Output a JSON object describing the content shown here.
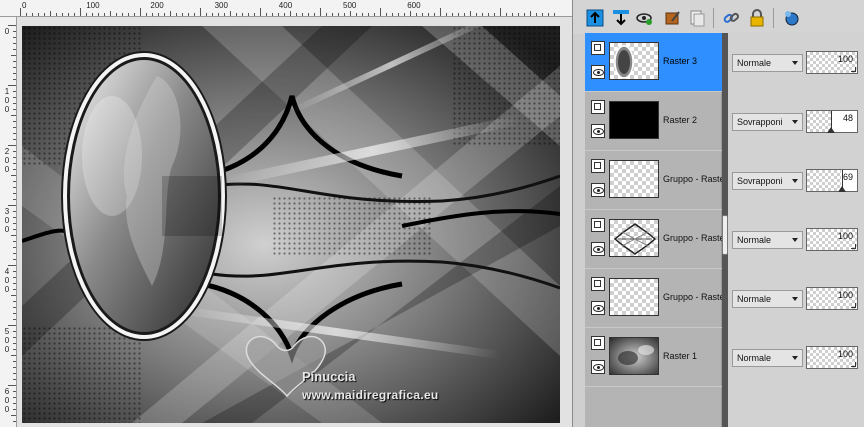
{
  "ruler": {
    "top_labels": [
      "0",
      "100",
      "200",
      "300",
      "400",
      "500",
      "600"
    ],
    "left_labels": [
      "0",
      "1\n0\n0",
      "2\n0\n0",
      "3\n0\n0",
      "4\n0\n0",
      "5\n0\n0",
      "6\n0\n0"
    ]
  },
  "canvas": {
    "watermark_name": "Pinuccia",
    "watermark_site": "www.maidiregrafica.eu"
  },
  "toolbar": {
    "icons": [
      "new-raster-layer-icon",
      "new-layer-below-icon",
      "visibility-toggle-icon",
      "mask-edit-icon",
      "duplicate-layer-icon",
      "link-icon",
      "lock-icon",
      "layer-effects-icon"
    ]
  },
  "layers": [
    {
      "name": "Raster 3",
      "blend": "Normale",
      "opacity": 100,
      "selected": true
    },
    {
      "name": "Raster 2",
      "blend": "Sovrapponi",
      "opacity": 48,
      "selected": false
    },
    {
      "name": "Gruppo - Raster",
      "blend": "Sovrapponi",
      "opacity": 69,
      "selected": false
    },
    {
      "name": "Gruppo - Raster",
      "blend": "Normale",
      "opacity": 100,
      "selected": false
    },
    {
      "name": "Gruppo - Raster",
      "blend": "Normale",
      "opacity": 100,
      "selected": false
    },
    {
      "name": "Raster 1",
      "blend": "Normale",
      "opacity": 100,
      "selected": false
    }
  ],
  "colors": {
    "selection": "#2f8fff",
    "panel_bg": "#cfcfcf"
  }
}
